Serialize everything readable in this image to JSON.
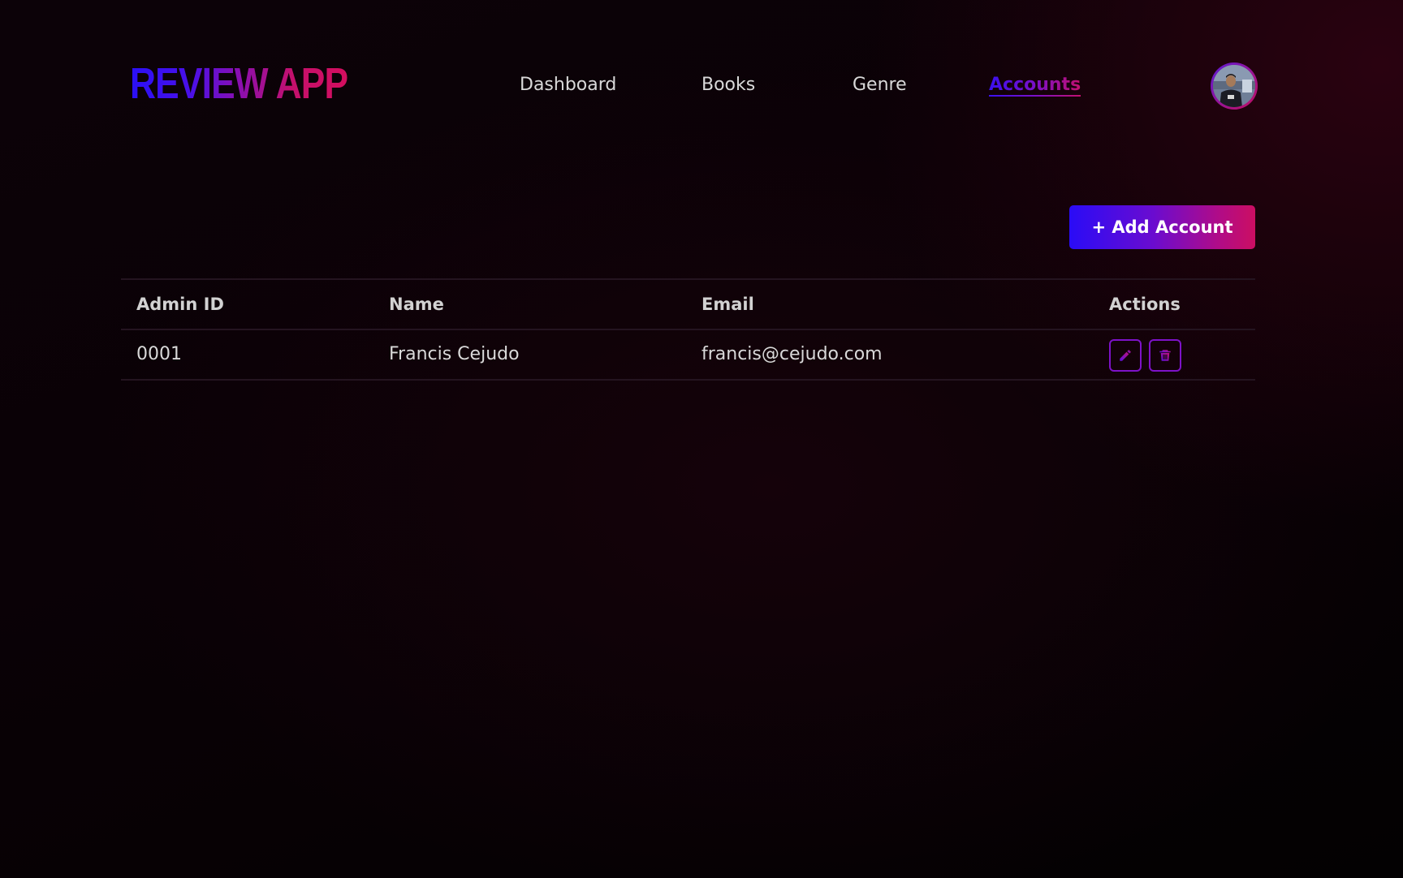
{
  "brand": {
    "title": "REVIEW APP"
  },
  "nav": {
    "items": [
      {
        "label": "Dashboard"
      },
      {
        "label": "Books"
      },
      {
        "label": "Genre"
      },
      {
        "label": "Accounts",
        "active": true
      }
    ]
  },
  "user": {
    "avatar_icon": "user-photo-avatar"
  },
  "toolbar": {
    "add_label": "+ Add Account"
  },
  "table": {
    "columns": [
      "Admin ID",
      "Name",
      "Email",
      "Actions"
    ],
    "rows": [
      {
        "admin_id": "0001",
        "name": "Francis Cejudo",
        "email": "francis@cejudo.com",
        "actions": [
          "pencil-icon",
          "trash-icon"
        ]
      }
    ]
  },
  "colors": {
    "background": "#0a0106",
    "gradient_start": "#2a0cf6",
    "gradient_mid": "#7d12c8",
    "gradient_end": "#cc0e62",
    "text": "#d9d9d9",
    "divider": "#241420"
  }
}
